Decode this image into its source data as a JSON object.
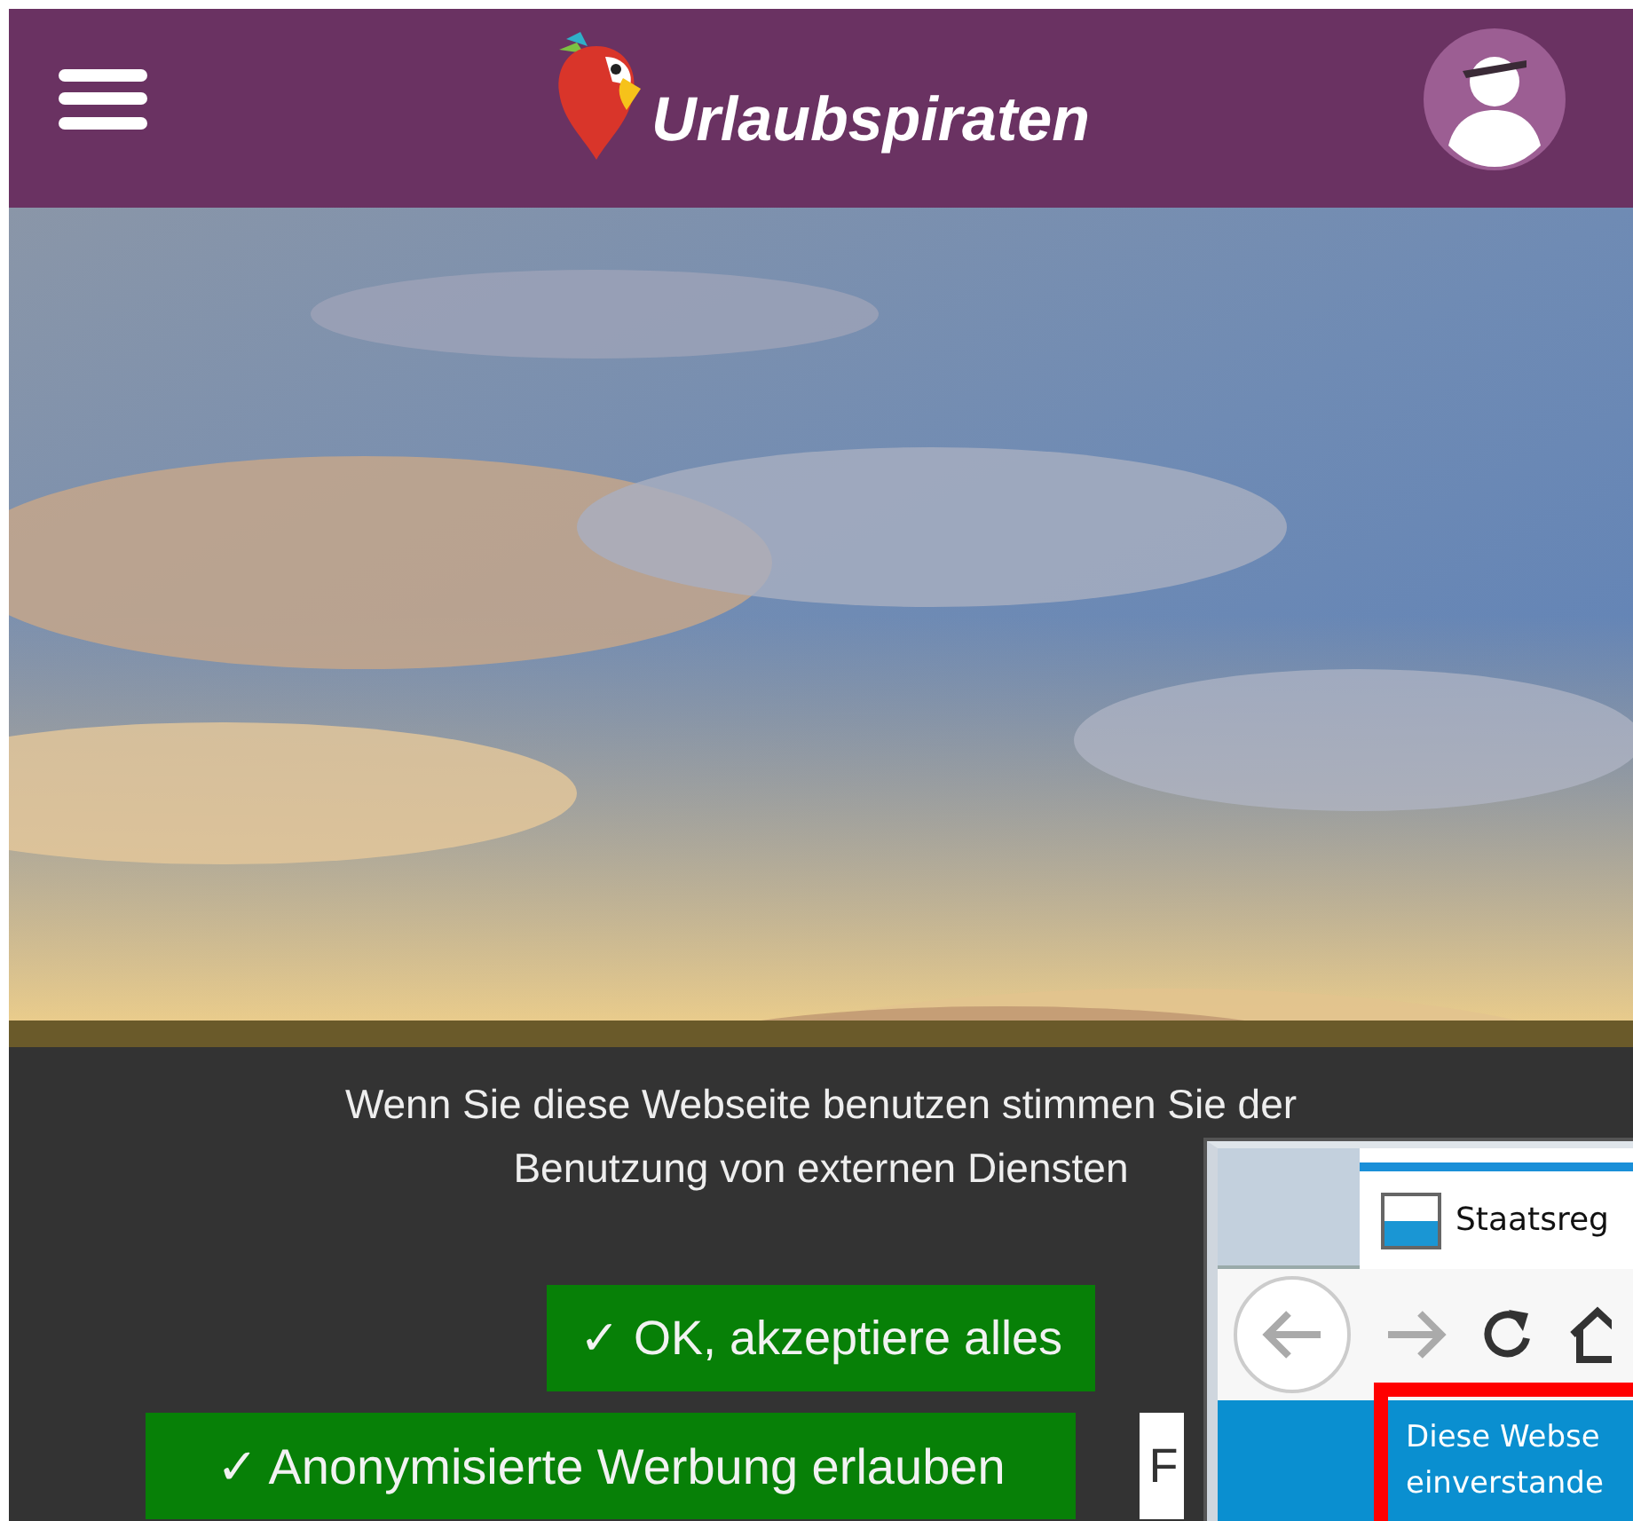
{
  "header": {
    "logo_text": "Urlaubspiraten"
  },
  "consent": {
    "lines": [
      "Wenn Sie diese Webseite benutzen stimmen Sie der",
      "Benutzung von externen Diensten"
    ],
    "button_rows": [
      [
        {
          "label": "✓ OK, akzeptiere alles",
          "kind": "primary"
        }
      ],
      [
        {
          "label": "✓ Anonymisierte Werbung erlauben",
          "kind": "primary"
        },
        {
          "label": "F",
          "kind": "secondary"
        }
      ]
    ]
  },
  "overlay_window": {
    "tab_title": "Staatsreg",
    "content_lines": [
      "Diese Webse",
      "einverstande"
    ]
  }
}
